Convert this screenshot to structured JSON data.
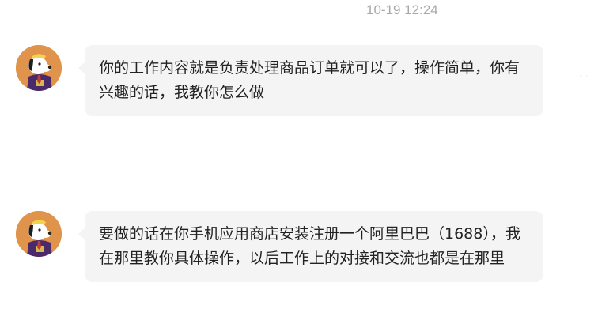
{
  "timestamp": "10-19 12:24",
  "messages": [
    {
      "sender": "other",
      "text": "你的工作内容就是负责处理商品订单就可以了，操作简单，你有兴趣的话，我教你怎么做"
    },
    {
      "sender": "other",
      "text": "要做的话在你手机应用商店安装注册一个阿里巴巴（1688），我在那里教你具体操作，以后工作上的对接和交流也都是在那里"
    }
  ],
  "colors": {
    "bubble_bg": "#f4f4f4",
    "avatar_bg": "#e0934a",
    "timestamp": "#a8a8a8"
  },
  "icons": {
    "avatar": "cartoon-dog-avatar-icon"
  }
}
